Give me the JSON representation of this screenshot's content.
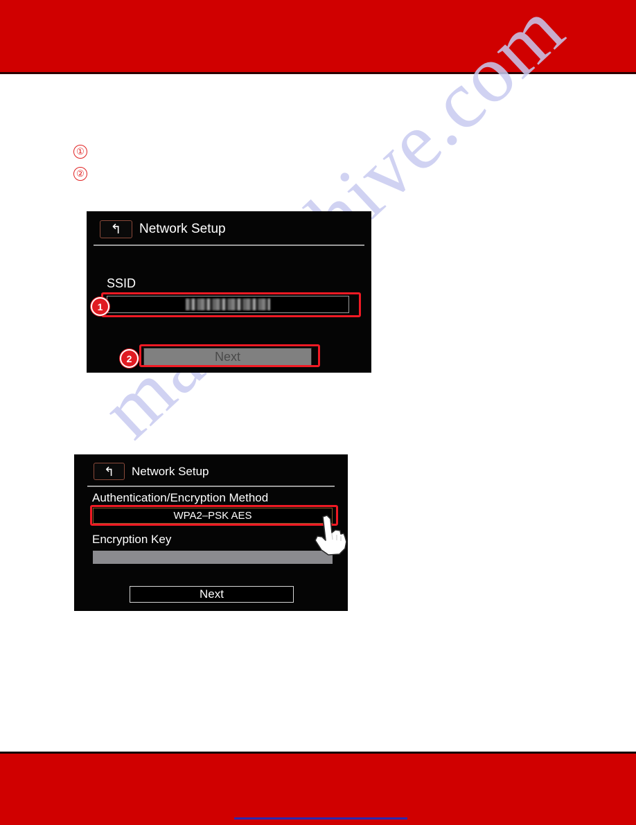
{
  "page": {
    "banner_color": "#d00000",
    "footer_rule_color": "#2a2ab0",
    "watermark": "manualshive.com",
    "highlight_color": "#f01a24"
  },
  "steps": [
    {
      "marker": "①"
    },
    {
      "marker": "②"
    }
  ],
  "screen1": {
    "back_icon": "back-arrow-icon",
    "back_glyph": "↰",
    "title": "Network Setup",
    "ssid_label": "SSID",
    "ssid_value": "",
    "ssid_value_state": "redacted",
    "next_label": "Next",
    "badges": [
      {
        "label": "1"
      },
      {
        "label": "2"
      }
    ]
  },
  "screen2": {
    "back_icon": "back-arrow-icon",
    "back_glyph": "↰",
    "title": "Network Setup",
    "auth_label": "Authentication/Encryption Method",
    "auth_value": "WPA2–PSK AES",
    "key_label": "Encryption Key",
    "key_value": "",
    "next_label": "Next",
    "cursor_icon": "pointing-hand-cursor-icon"
  }
}
